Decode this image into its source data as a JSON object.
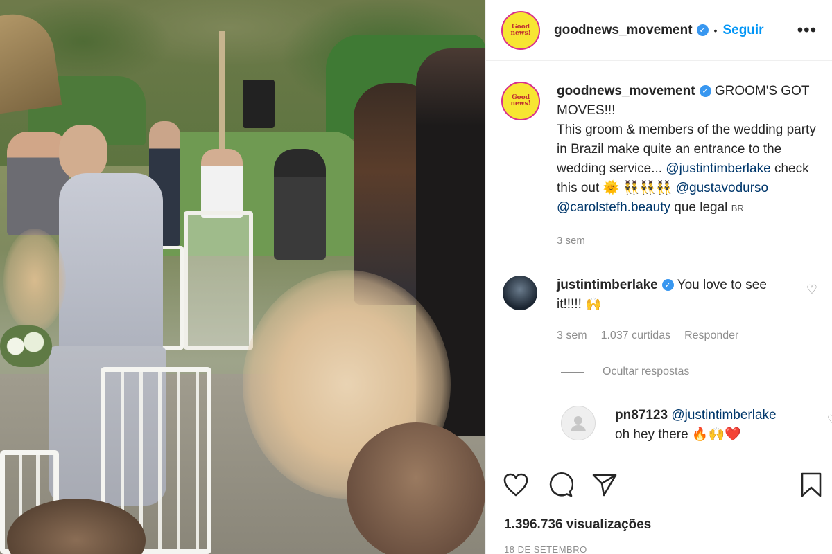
{
  "post": {
    "username": "goodnews_movement",
    "follow_label": "Seguir",
    "more_label": "•••",
    "avatar_text": "Good news!",
    "separator": "•"
  },
  "caption": {
    "username": "goodnews_movement",
    "headline": "GROOM'S GOT MOVES!!!",
    "body": "This groom & members of the wedding party in Brazil make quite an entrance to the wedding service... ",
    "mention1": "@justintimberlake",
    "check": "check this out 🌞 👯‍♂️👯‍♂️👯‍♂️ ",
    "mention2": "@gustavodurso",
    "mention3": "@carolstefh.beauty",
    "tail": " que legal ",
    "flag": "BR",
    "time": "3 sem"
  },
  "comments": [
    {
      "username": "justintimberlake",
      "text": "You love to see it!!!!! 🙌",
      "time": "3 sem",
      "likes": "1.037 curtidas",
      "reply_label": "Responder"
    }
  ],
  "hide_replies_label": "Ocultar respostas",
  "reply": {
    "username": "pn87123",
    "mention": "@justintimberlake",
    "text": "oh hey there 🔥🙌❤️"
  },
  "stats": {
    "views": "1.396.736 visualizações",
    "date": "18 DE SETEMBRO"
  },
  "colors": {
    "accent": "#0095f6",
    "verified": "#3897f0",
    "mention": "#00376b",
    "muted": "#8e8e8e"
  }
}
